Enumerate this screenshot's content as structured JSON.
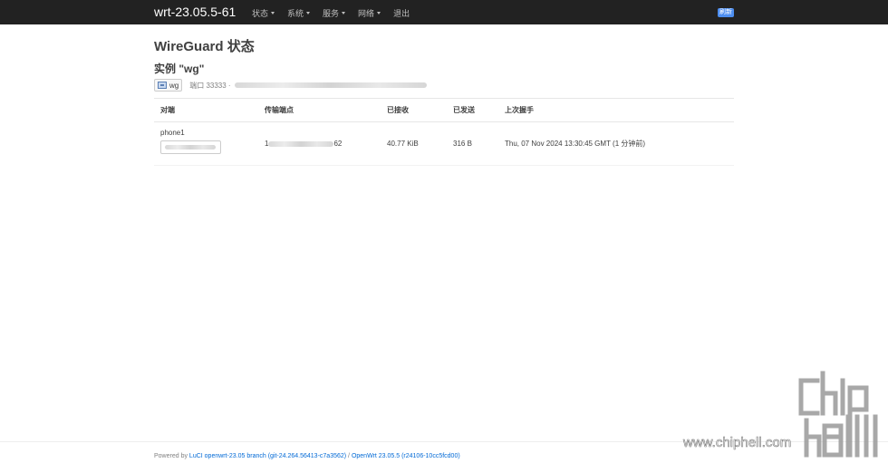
{
  "navbar": {
    "brand": "wrt-23.05.5-61",
    "menu": [
      "状态",
      "系统",
      "服务",
      "网络",
      "退出"
    ],
    "refresh_label": "刷新"
  },
  "page_title": "WireGuard 状态",
  "instance_title": "实例 \"wg\"",
  "interface": {
    "name": "wg",
    "port_text": "端口 33333 ·"
  },
  "table": {
    "headers": [
      "对端",
      "传输端点",
      "已接收",
      "已发送",
      "上次握手"
    ],
    "rows": [
      {
        "peer": "phone1",
        "endpoint_start": "1",
        "endpoint_end": "62",
        "received": "40.77 KiB",
        "sent": "316 B",
        "handshake": "Thu, 07 Nov 2024 13:30:45 GMT (1 分钟前)"
      }
    ]
  },
  "footer": {
    "prefix": "Powered by",
    "luci": "LuCI openwrt-23.05 branch (git-24.264.56413-c7a3562)",
    "separator": "/",
    "openwrt": "OpenWrt 23.05.5 (r24106-10cc5fcd00)"
  },
  "watermark": {
    "url": "www.chiphell.com",
    "logo_text": "chip hell"
  },
  "colors": {
    "navbar_bg": "#222222",
    "link": "#0069d6",
    "refresh_bg": "#4d8ef0"
  }
}
